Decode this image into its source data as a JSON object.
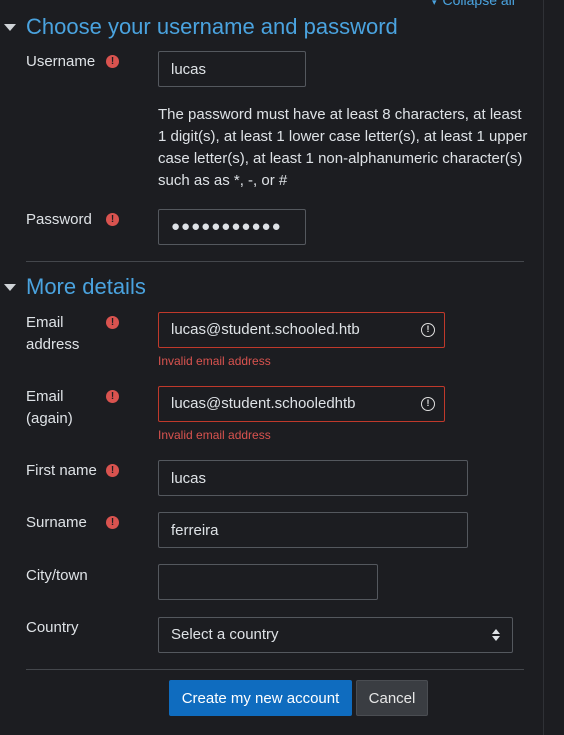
{
  "collapse_all": "Collapse all",
  "section1": {
    "title": "Choose your username and password",
    "username_label": "Username",
    "username_value": "lucas",
    "password_help": "The password must have at least 8 characters, at least 1 digit(s), at least 1 lower case letter(s), at least 1 upper case letter(s), at least 1 non-alphanumeric character(s) such as as *, -, or #",
    "password_label": "Password",
    "password_value": "●●●●●●●●●●●"
  },
  "section2": {
    "title": "More details",
    "email_label_line1": "Email",
    "email_label_line2": "address",
    "email_value": "lucas@student.schooled.htb",
    "email_error": "Invalid email address",
    "email2_label_line1": "Email",
    "email2_label_line2": "(again)",
    "email2_value": "lucas@student.schooledhtb",
    "email2_error": "Invalid email address",
    "firstname_label": "First name",
    "firstname_value": "lucas",
    "surname_label": "Surname",
    "surname_value": "ferreira",
    "city_label": "City/town",
    "city_value": "",
    "country_label": "Country",
    "country_value": "Select a country"
  },
  "required_mark": "!",
  "invalid_mark": "!",
  "buttons": {
    "create": "Create my new account",
    "cancel": "Cancel"
  },
  "colors": {
    "accent": "#4aa3df",
    "primary_button": "#0f6cbf",
    "error": "#d9534f",
    "background": "#1c1d21"
  }
}
